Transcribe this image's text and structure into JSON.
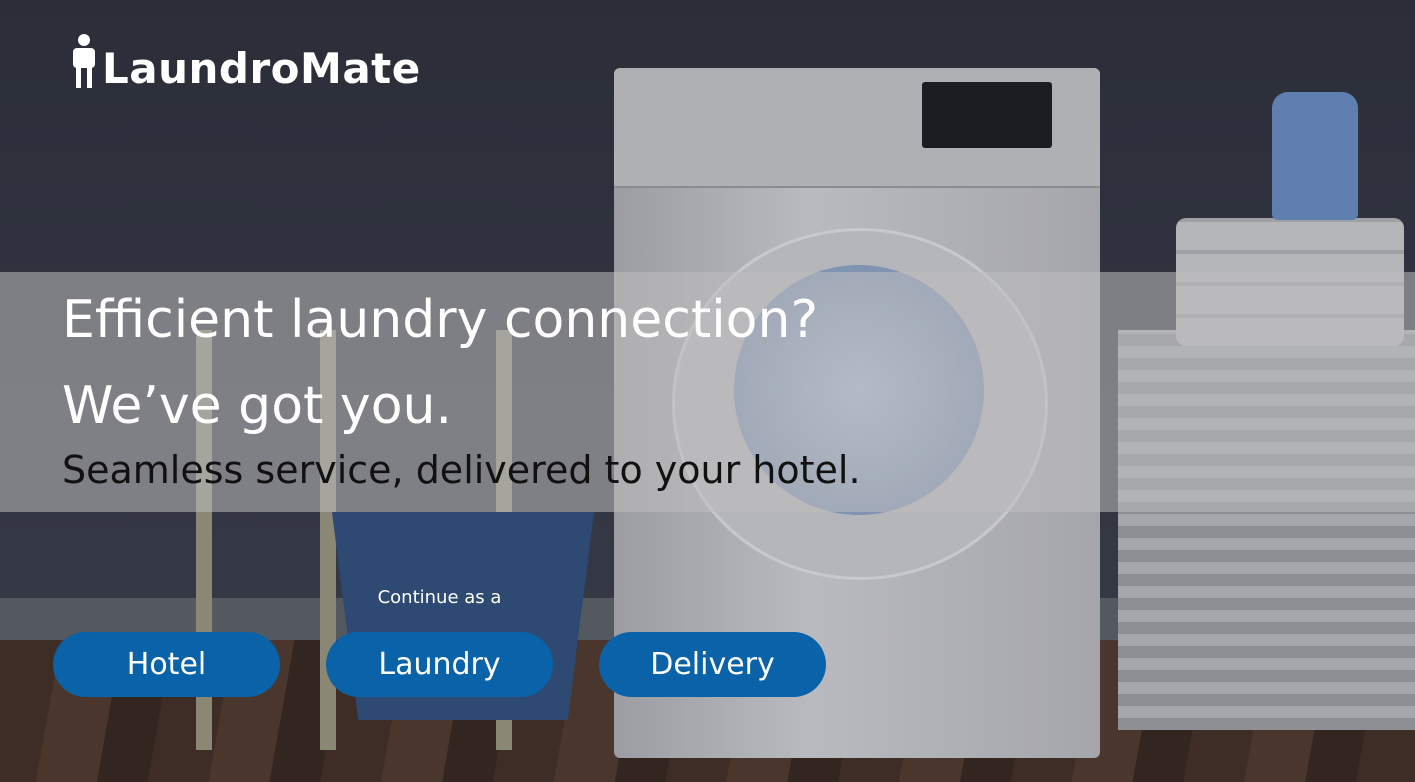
{
  "brand": {
    "name": "LaundroMate",
    "logo_icon": "person-carrying-box-icon"
  },
  "hero": {
    "headline_line1": "Efficient laundry connection?",
    "headline_line2": "We’ve got you.",
    "subtitle": "Seamless service, delivered to your hotel."
  },
  "role_select": {
    "prompt": "Continue as a",
    "options": [
      {
        "label": "Hotel"
      },
      {
        "label": "Laundry"
      },
      {
        "label": "Delivery"
      }
    ],
    "button_color": "#0a62a8"
  }
}
